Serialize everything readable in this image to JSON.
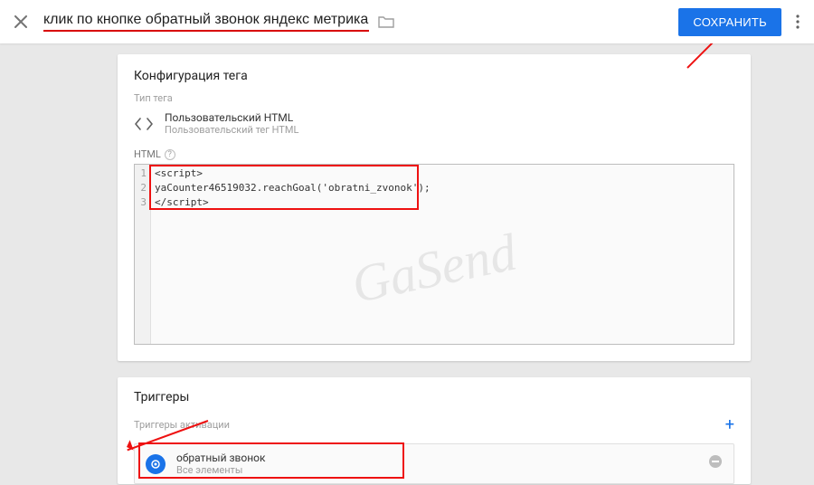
{
  "header": {
    "tag_title": "клик по кнопке обратный звонок яндекс метрика",
    "save_label": "СОХРАНИТЬ"
  },
  "tag_config": {
    "section_title": "Конфигурация тега",
    "type_label": "Тип тега",
    "tag_type_name": "Пользовательский HTML",
    "tag_type_sub": "Пользовательский тег HTML",
    "html_label": "HTML",
    "code_lines": {
      "n1": "1",
      "n2": "2",
      "n3": "3",
      "l1": "<script>",
      "l2": "yaCounter46519032.reachGoal('obratni_zvonok');",
      "l3": "</script>"
    }
  },
  "triggers": {
    "section_title": "Триггеры",
    "activation_label": "Триггеры активации",
    "items": [
      {
        "name": "обратный звонок",
        "sub": "Все элементы"
      }
    ]
  },
  "watermark_text": "GaSend"
}
